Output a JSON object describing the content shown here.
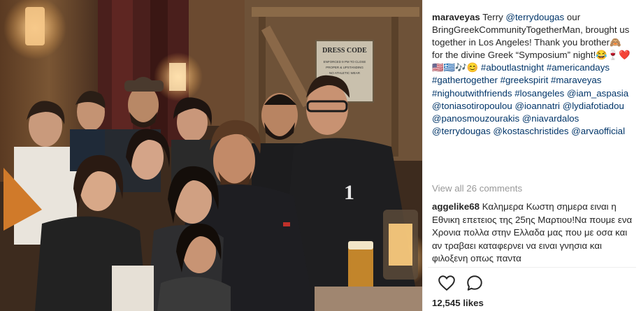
{
  "post": {
    "username": "maraveyas",
    "caption_parts": [
      {
        "text": "Terry ",
        "type": "text"
      },
      {
        "text": "@terrydougas",
        "type": "link"
      },
      {
        "text": " our BringGreekCommunityTogetherMan, brought us together in Los Angeles! Thank you brother🙈 for the divine Greek “Symposium” night!😂🍷❤️🇺🇸🇬🇷🎶😊 ",
        "type": "text"
      },
      {
        "text": "#aboutlastnight",
        "type": "link"
      },
      {
        "text": " ",
        "type": "text"
      },
      {
        "text": "#americandays",
        "type": "link"
      },
      {
        "text": " ",
        "type": "text"
      },
      {
        "text": "#gathertogether",
        "type": "link"
      },
      {
        "text": " ",
        "type": "text"
      },
      {
        "text": "#greekspirit",
        "type": "link"
      },
      {
        "text": " ",
        "type": "text"
      },
      {
        "text": "#maraveyas",
        "type": "link"
      },
      {
        "text": " ",
        "type": "text"
      },
      {
        "text": "#nighoutwithfriends",
        "type": "link"
      },
      {
        "text": " ",
        "type": "text"
      },
      {
        "text": "#losangeles",
        "type": "link"
      },
      {
        "text": " ",
        "type": "text"
      },
      {
        "text": "@iam_aspasia",
        "type": "link"
      },
      {
        "text": " ",
        "type": "text"
      },
      {
        "text": "@toniasotiropoulou",
        "type": "link"
      },
      {
        "text": " ",
        "type": "text"
      },
      {
        "text": "@ioannatri",
        "type": "link"
      },
      {
        "text": " ",
        "type": "text"
      },
      {
        "text": "@lydiafotiadou",
        "type": "link"
      },
      {
        "text": " ",
        "type": "text"
      },
      {
        "text": "@panosmouzourakis",
        "type": "link"
      },
      {
        "text": " ",
        "type": "text"
      },
      {
        "text": "@niavardalos",
        "type": "link"
      },
      {
        "text": " ",
        "type": "text"
      },
      {
        "text": "@terrydougas",
        "type": "link"
      },
      {
        "text": " ",
        "type": "text"
      },
      {
        "text": "@kostaschristides",
        "type": "link"
      },
      {
        "text": " ",
        "type": "text"
      },
      {
        "text": "@arvaofficial",
        "type": "link"
      }
    ],
    "view_all_comments": "View all 26 comments",
    "comment": {
      "username": "aggelike68",
      "text": "Καλημερα Κωστη σημερα ειναι η Εθνικη επετειος της 25ης Μαρτιου!Να πουμε ενα Χρονια πολλα στην Ελλαδα μας που με οσα και αν τραβαει καταφερνει να ειναι γνησια και φιλοξενη οπως παντα"
    },
    "actions": [
      {
        "name": "like-icon"
      },
      {
        "name": "comment-icon"
      }
    ],
    "likes": "12,545 likes",
    "photo": {
      "sign_title": "DRESS CODE",
      "sign_lines": [
        "ENFORCED 9 PM TO CLOSE",
        "PROPER & UPSTANDING",
        "NO ATHLETIC WEAR"
      ],
      "jacket_number": "1"
    },
    "colors": {
      "link": "#003569",
      "text": "#262626",
      "muted": "#999999",
      "border": "#efefef"
    }
  }
}
